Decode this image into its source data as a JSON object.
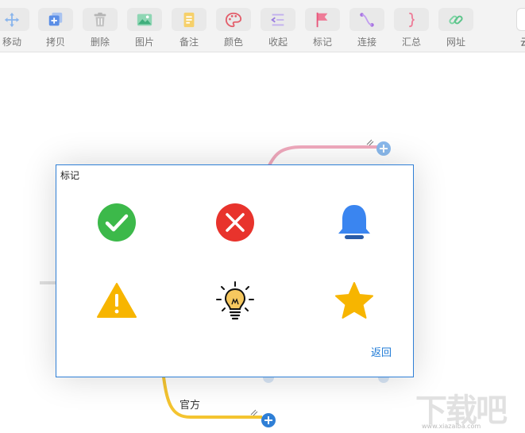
{
  "toolbar": {
    "items": [
      {
        "label": "移动",
        "icon": "move-arrows-icon",
        "color": "#6aa3e8"
      },
      {
        "label": "拷贝",
        "icon": "copy-icon",
        "color": "#5b8ee6"
      },
      {
        "label": "删除",
        "icon": "trash-icon",
        "color": "#9a9a9a"
      },
      {
        "label": "图片",
        "icon": "image-icon",
        "color": "#4cbf8c"
      },
      {
        "label": "备注",
        "icon": "note-icon",
        "color": "#f2c34a"
      },
      {
        "label": "颜色",
        "icon": "palette-icon",
        "color": "#e35d6a"
      },
      {
        "label": "收起",
        "icon": "collapse-icon",
        "color": "#9b7de0"
      },
      {
        "label": "标记",
        "icon": "flag-icon",
        "color": "#e8557a"
      },
      {
        "label": "连接",
        "icon": "connect-icon",
        "color": "#a56ee0"
      },
      {
        "label": "汇总",
        "icon": "summary-brace-icon",
        "color": "#e8557a"
      },
      {
        "label": "网址",
        "icon": "link-icon",
        "color": "#5bc48a"
      }
    ],
    "cut_label": "云"
  },
  "canvas": {
    "node_label": "官方",
    "colors": {
      "pink_branch": "#f0a9bd",
      "yellow_branch": "#f4c430",
      "gray_branch": "#e0e0e0",
      "add_button": "#2f7fd6"
    }
  },
  "dialog": {
    "title": "标记",
    "markers": [
      {
        "name": "check-mark",
        "icon": "check-circle-icon",
        "color": "#3cb94a"
      },
      {
        "name": "cross-mark",
        "icon": "cross-circle-icon",
        "color": "#e8332c"
      },
      {
        "name": "bell-mark",
        "icon": "bell-icon",
        "color": "#3a85f0"
      },
      {
        "name": "warning-mark",
        "icon": "warning-triangle-icon",
        "color": "#f7b500"
      },
      {
        "name": "bulb-mark",
        "icon": "lightbulb-icon",
        "color": "#f6c85f"
      },
      {
        "name": "star-mark",
        "icon": "star-icon",
        "color": "#f7b500"
      }
    ],
    "back_label": "返回"
  },
  "watermark": {
    "text": "下载吧",
    "sub": "www.xiazaiba.com"
  }
}
